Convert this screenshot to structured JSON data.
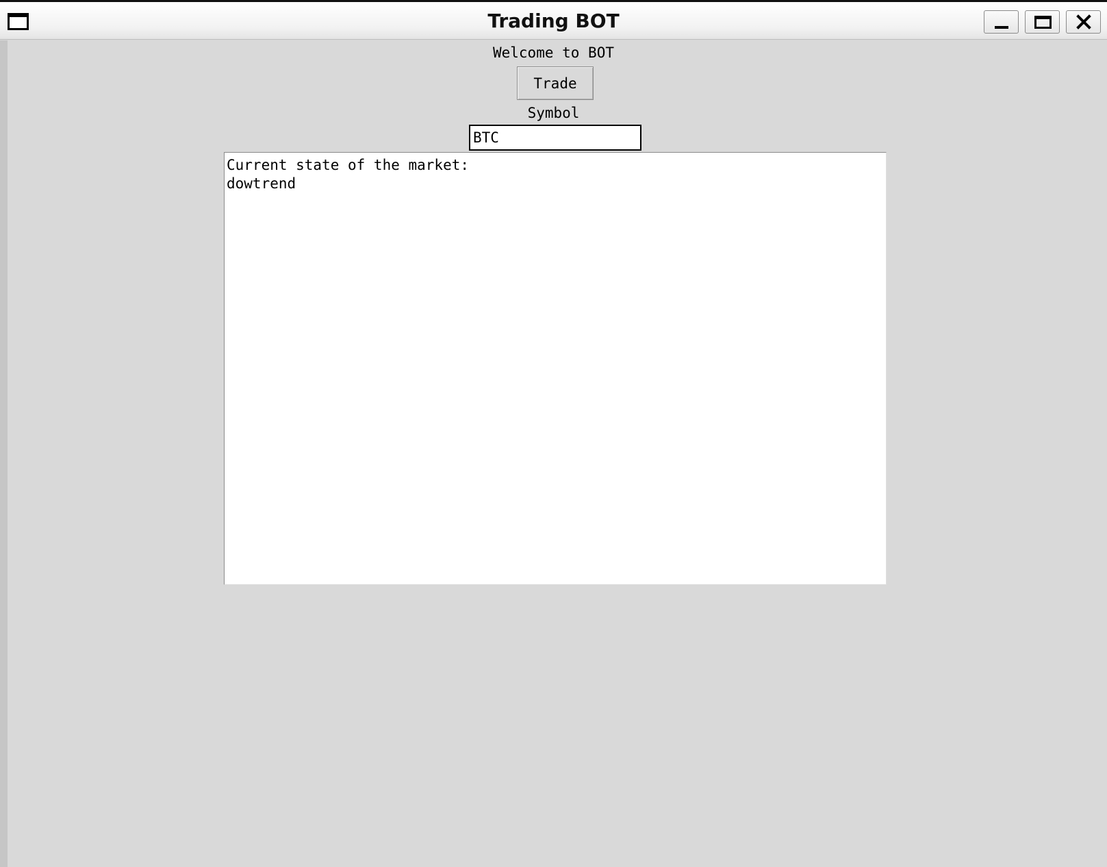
{
  "window": {
    "title": "Trading BOT",
    "controls": {
      "minimize_icon": "minimize-icon",
      "maximize_icon": "maximize-icon",
      "close_icon": "close-icon"
    }
  },
  "main": {
    "welcome_text": "Welcome to BOT",
    "trade_button_label": "Trade",
    "symbol_label": "Symbol",
    "symbol_value": "BTC",
    "output_lines": [
      "Current state of the market:",
      "dowtrend"
    ]
  },
  "colors": {
    "window_background": "#d9d9d9",
    "text_area_background": "#ffffff"
  }
}
